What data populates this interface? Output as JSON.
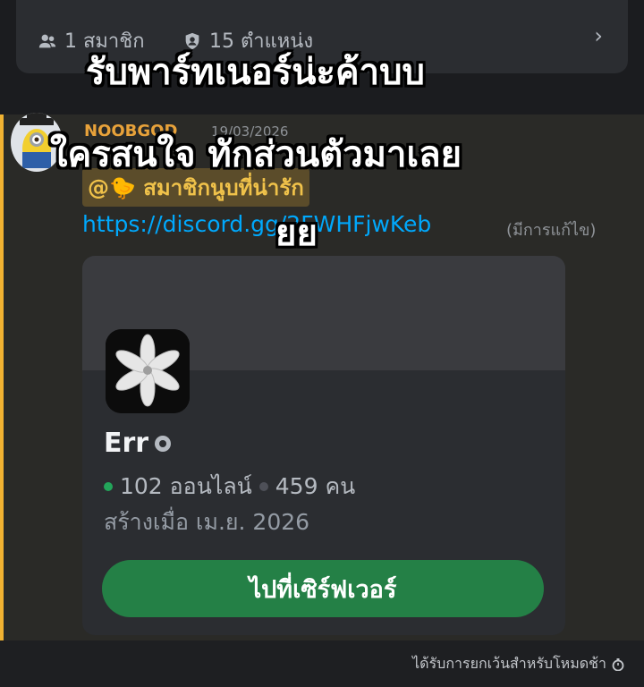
{
  "header": {
    "members_text": "1 สมาชิก",
    "roles_text": "15 ตำแหน่ง",
    "chevron": "›"
  },
  "message": {
    "author": "NOOBGOD",
    "timestamp": "19/03/2026",
    "mention": "@🐤 สมาชิกนูบที่น่ารัก",
    "link": "https://discord.gg/2FWHFjwKeb",
    "edited": "(มีการแก้ไข)"
  },
  "invite": {
    "server_name": "Err",
    "online": "102 ออนไลน์",
    "members": "459 คน",
    "created": "สร้างเมื่อ เม.ย. 2026",
    "join_label": "ไปที่เซิร์ฟเวอร์"
  },
  "footer": {
    "slowmode_text": "ได้รับการยกเว้นสำหรับโหมดช้า"
  },
  "overlay": {
    "line1": "รับพาร์ทเนอร์น่ะค้าบบ",
    "line2": "ใครสนใจ ทักส่วนตัวมาเลย",
    "line3": "ยย"
  },
  "colors": {
    "accent_green": "#248046",
    "mention": "#f0c24a",
    "link": "#00a8fc",
    "online": "#23a55a"
  }
}
